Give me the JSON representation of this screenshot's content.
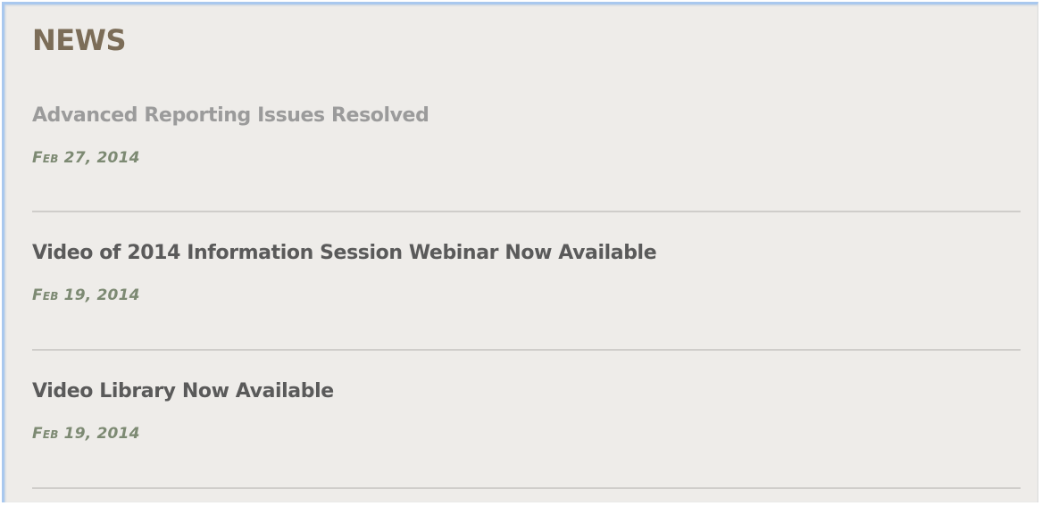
{
  "news": {
    "heading": "NEWS",
    "items": [
      {
        "title": "Advanced Reporting Issues Resolved",
        "date": "Feb 27, 2014"
      },
      {
        "title": "Video of 2014 Information Session Webinar Now Available",
        "date": "Feb 19, 2014"
      },
      {
        "title": "Video Library Now Available",
        "date": "Feb 19, 2014"
      }
    ]
  },
  "colors": {
    "heading": "#7c6d58",
    "title": "#5a5a5a",
    "title_visited": "#9b9b9b",
    "date": "#7d8a73",
    "panel_background": "#eeece9"
  }
}
